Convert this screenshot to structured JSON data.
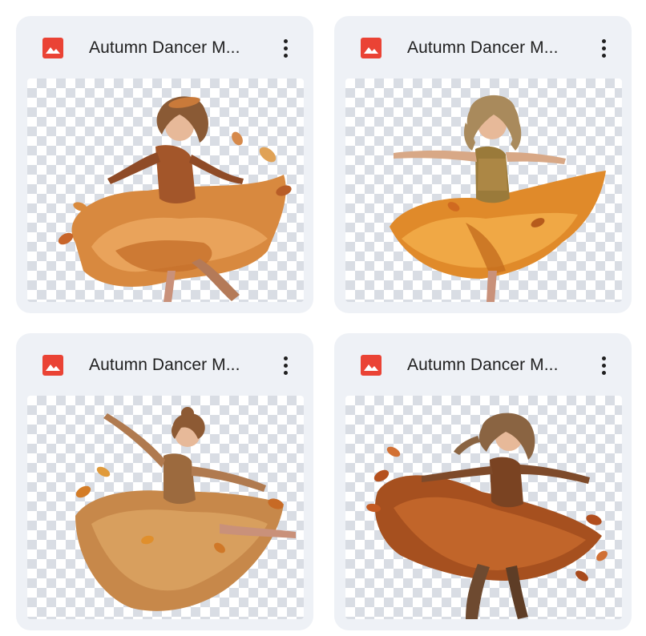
{
  "files": [
    {
      "title": "Autumn Dancer M...",
      "icon": "image-file-icon",
      "pose": "twirl-left"
    },
    {
      "title": "Autumn Dancer M...",
      "icon": "image-file-icon",
      "pose": "arms-out"
    },
    {
      "title": "Autumn Dancer M...",
      "icon": "image-file-icon",
      "pose": "arm-raised"
    },
    {
      "title": "Autumn Dancer M...",
      "icon": "image-file-icon",
      "pose": "leap-right"
    }
  ],
  "colors": {
    "card_bg": "#eef1f6",
    "icon_red": "#ea4335",
    "text": "#1f1f1f",
    "checker": "#d9dde4"
  }
}
